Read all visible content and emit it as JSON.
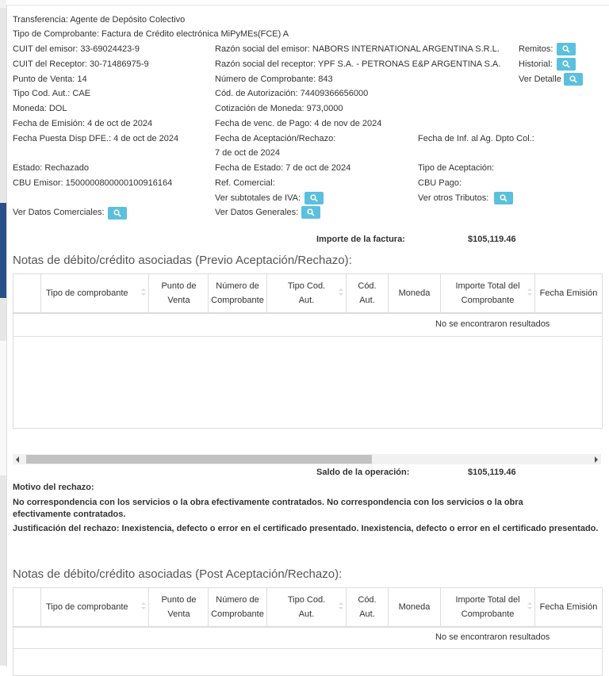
{
  "invoice": {
    "transferencia": "Transferencia: Agente de Depósito Colectivo",
    "tipo_comprobante": "Tipo de Comprobante: Factura de Crédito electrónica MiPyMEs(FCE) A",
    "cuit_emisor": "CUIT del emisor: 33-69024423-9",
    "razon_emisor": "Razón social del emisor: NABORS INTERNATIONAL ARGENTINA S.R.L.",
    "remitos": "Remitos:",
    "cuit_receptor": "CUIT del Receptor: 30-71486975-9",
    "razon_receptor": "Razón social del receptor: YPF S.A. - PETRONAS E&P ARGENTINA S.A.",
    "historial": "Historial:",
    "punto_venta": "Punto de Venta: 14",
    "numero_comprobante": "Número de Comprobante: 843",
    "ver_detalle": "Ver Detalle",
    "tipo_cod_aut": "Tipo Cod. Aut.: CAE",
    "cod_autorizacion": "Cód. de Autorización: 74409366656000",
    "moneda": "Moneda: DOL",
    "cotizacion": "Cotización de Moneda: 973,0000",
    "fecha_emision": "Fecha de Emisión: 4 de oct de 2024",
    "fecha_venc_pago": "Fecha de venc. de Pago: 4 de nov de 2024",
    "fecha_puesta": "Fecha Puesta Disp DFE.: 4 de oct de 2024",
    "fecha_acept_label": "Fecha de Aceptación/Rechazo:",
    "fecha_acept_value": "7 de oct de 2024",
    "fecha_inf": "Fecha de Inf. al Ag. Dpto Col.:",
    "estado": "Estado: Rechazado",
    "fecha_estado": "Fecha de Estado: 7 de oct de 2024",
    "tipo_aceptacion": "Tipo de Aceptación:",
    "cbu_emisor": "CBU Emisor: 1500000800000100916164",
    "ref_comercial": "Ref. Comercial:",
    "cbu_pago": "CBU Pago:",
    "ver_subtotales": "Ver subtotales de IVA:",
    "ver_otros_tributos": "Ver otros Tributos:",
    "ver_datos_comerciales": "Ver Datos Comerciales:",
    "ver_datos_generales": "Ver Datos Generales:",
    "importe_label": "Importe de la factura:",
    "importe_value": "$105,119.46"
  },
  "section_pre": {
    "title": "Notas de débito/crédito asociadas (Previo Aceptación/Rechazo):",
    "no_results": "No se encontraron resultados"
  },
  "columns": [
    "",
    "Tipo de comprobante",
    "Punto de Venta",
    "Número de Comprobante",
    "Tipo Cod. Aut.",
    "Cód. Aut.",
    "Moneda",
    "Importe Total del Comprobante",
    "Fecha Emisión"
  ],
  "saldo": {
    "label": "Saldo de la operación:",
    "value": "$105,119.46"
  },
  "rechazo": {
    "motivo_label": "Motivo del rechazo:",
    "motivo_text": "No correspondencia con los servicios o la obra efectivamente contratados. No correspondencia con los servicios o la obra efectivamente contratados.",
    "justificacion": "Justificación del rechazo: Inexistencia, defecto o error en el certificado presentado. Inexistencia, defecto o error en el certificado presentado."
  },
  "section_post": {
    "title": "Notas de débito/crédito asociadas (Post Aceptación/Rechazo):",
    "no_results": "No se encontraron resultados"
  },
  "colors": {
    "button": "#5bc0de",
    "border": "#dddddd",
    "thumb": "#c1c1c1"
  },
  "icons": {
    "search": "search-icon"
  }
}
